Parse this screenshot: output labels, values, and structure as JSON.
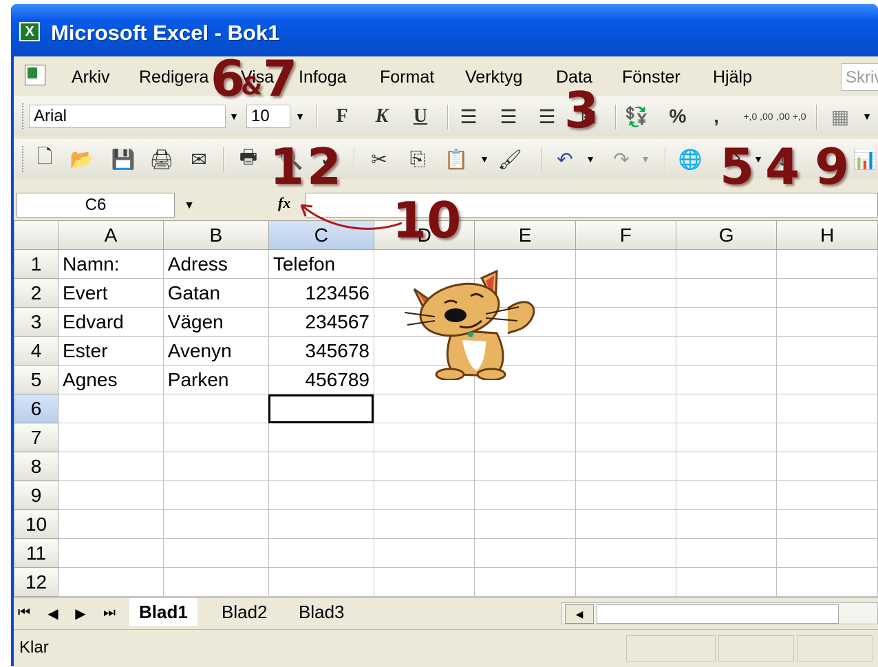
{
  "window": {
    "title": "Microsoft Excel - Bok1",
    "icon": "excel-icon"
  },
  "menu": {
    "items": [
      "Arkiv",
      "Redigera",
      "Visa",
      "Infoga",
      "Format",
      "Verktyg",
      "Data",
      "Fönster",
      "Hjälp"
    ],
    "help_placeholder": "Skriv"
  },
  "format_toolbar": {
    "font": "Arial",
    "size": "10",
    "bold": "F",
    "italic": "K",
    "underline": "U",
    "percent": "%",
    "comma": ",",
    "inc_decimal": "+,0 ,00",
    "dec_decimal": ",00 +,0"
  },
  "formula_bar": {
    "name_box": "C6",
    "fx": "fx",
    "value": ""
  },
  "grid": {
    "columns": [
      "A",
      "B",
      "C",
      "D",
      "E",
      "F",
      "G",
      "H"
    ],
    "rows": [
      "1",
      "2",
      "3",
      "4",
      "5",
      "6",
      "7",
      "8",
      "9",
      "10",
      "11",
      "12"
    ],
    "cells": [
      [
        "Namn:",
        "Adress",
        "Telefon"
      ],
      [
        "Evert",
        "Gatan",
        "123456"
      ],
      [
        "Edvard",
        "Vägen",
        "234567"
      ],
      [
        "Ester",
        "Avenyn",
        "345678"
      ],
      [
        "Agnes",
        "Parken",
        "456789"
      ]
    ],
    "active_cell": "C6"
  },
  "sheets": {
    "tabs": [
      "Blad1",
      "Blad2",
      "Blad3"
    ],
    "active": "Blad1"
  },
  "status": {
    "text": "Klar"
  },
  "annotations": {
    "a1": "1",
    "a2": "2",
    "a3": "3",
    "a4": "4",
    "a5": "5",
    "a6": "6",
    "amp": "&",
    "a7": "7",
    "a9": "9",
    "a10": "10"
  },
  "colors": {
    "title_bar": "#0a5ae8",
    "annotation": "#7a1010",
    "selection_header": "#c4d7f2"
  }
}
